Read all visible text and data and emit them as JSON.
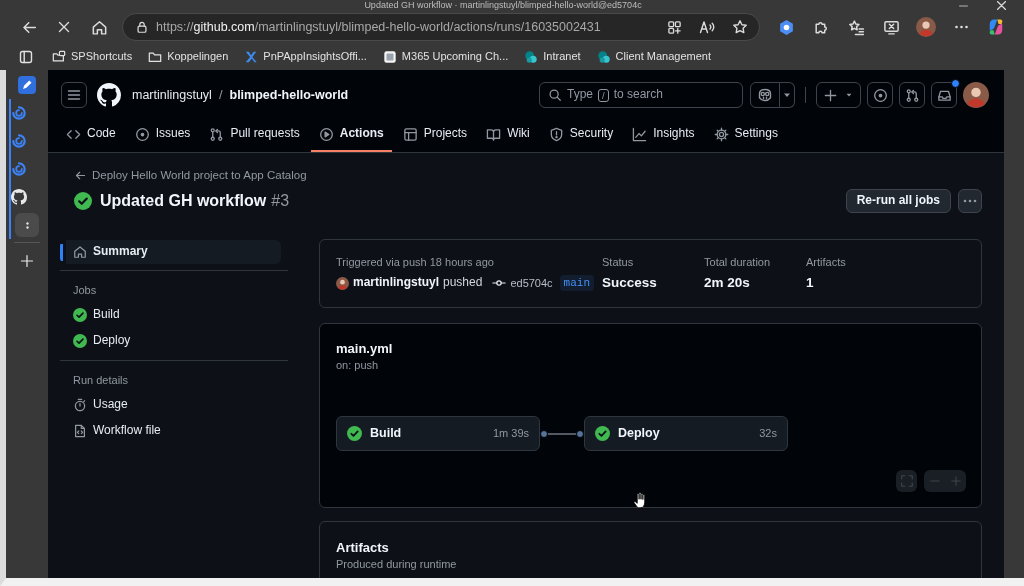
{
  "browser": {
    "window_title": "Updated GH workflow · martinlingstuyl/blimped-hello-world@ed5704c",
    "url": "https://**github.com**/martinlingstuyl/blimped-hello-world/actions/runs/16035002431",
    "bookmarks": [
      {
        "label": "SPShortcuts"
      },
      {
        "label": "Koppelingen"
      },
      {
        "label": "PnPAppInsightsOffi..."
      },
      {
        "label": "M365 Upcoming Ch..."
      },
      {
        "label": "Intranet"
      },
      {
        "label": "Client Management"
      }
    ]
  },
  "header": {
    "owner": "martinlingstuyl",
    "separator": "/",
    "repo": "blimped-hello-world",
    "search": {
      "before": "Type",
      "key": "/",
      "after": "to search"
    },
    "notifications_unread": true
  },
  "repo_tabs": [
    {
      "label": "Code",
      "selected": false
    },
    {
      "label": "Issues",
      "selected": false
    },
    {
      "label": "Pull requests",
      "selected": false
    },
    {
      "label": "Actions",
      "selected": true
    },
    {
      "label": "Projects",
      "selected": false
    },
    {
      "label": "Wiki",
      "selected": false
    },
    {
      "label": "Security",
      "selected": false
    },
    {
      "label": "Insights",
      "selected": false
    },
    {
      "label": "Settings",
      "selected": false
    }
  ],
  "run": {
    "back_link": "Deploy Hello World project to App Catalog",
    "title": "Updated GH workflow",
    "number": "#3",
    "succeeded": true,
    "rerun_button": "Re-run all jobs"
  },
  "sidebar": {
    "summary": {
      "label": "Summary",
      "selected": true
    },
    "groups": [
      {
        "heading": "Jobs",
        "items": [
          {
            "kind": "job",
            "label": "Build",
            "succeeded": true,
            "selected": false
          },
          {
            "kind": "job",
            "label": "Deploy",
            "succeeded": true,
            "selected": false
          }
        ]
      },
      {
        "heading": "Run details",
        "items": [
          {
            "kind": "detail",
            "label": "Usage",
            "selected": false
          },
          {
            "kind": "detail",
            "label": "Workflow file",
            "selected": false
          }
        ]
      }
    ]
  },
  "summary": {
    "trigger": "Triggered via push 18 hours ago",
    "actor": "martinlingstuyl",
    "action": "pushed",
    "commit": "ed5704c",
    "branch": "main",
    "stats": [
      {
        "label": "Status",
        "value": "Success"
      },
      {
        "label": "Total duration",
        "value": "2m 20s"
      },
      {
        "label": "Artifacts",
        "value": "1"
      }
    ]
  },
  "workflow": {
    "file": "main.yml",
    "trigger": "on: push",
    "jobs": [
      {
        "name": "Build",
        "succeeded": true,
        "duration": "1m 39s"
      },
      {
        "name": "Deploy",
        "succeeded": true,
        "duration": "32s"
      }
    ]
  },
  "artifacts": {
    "title": "Artifacts",
    "subtitle": "Produced during runtime"
  }
}
